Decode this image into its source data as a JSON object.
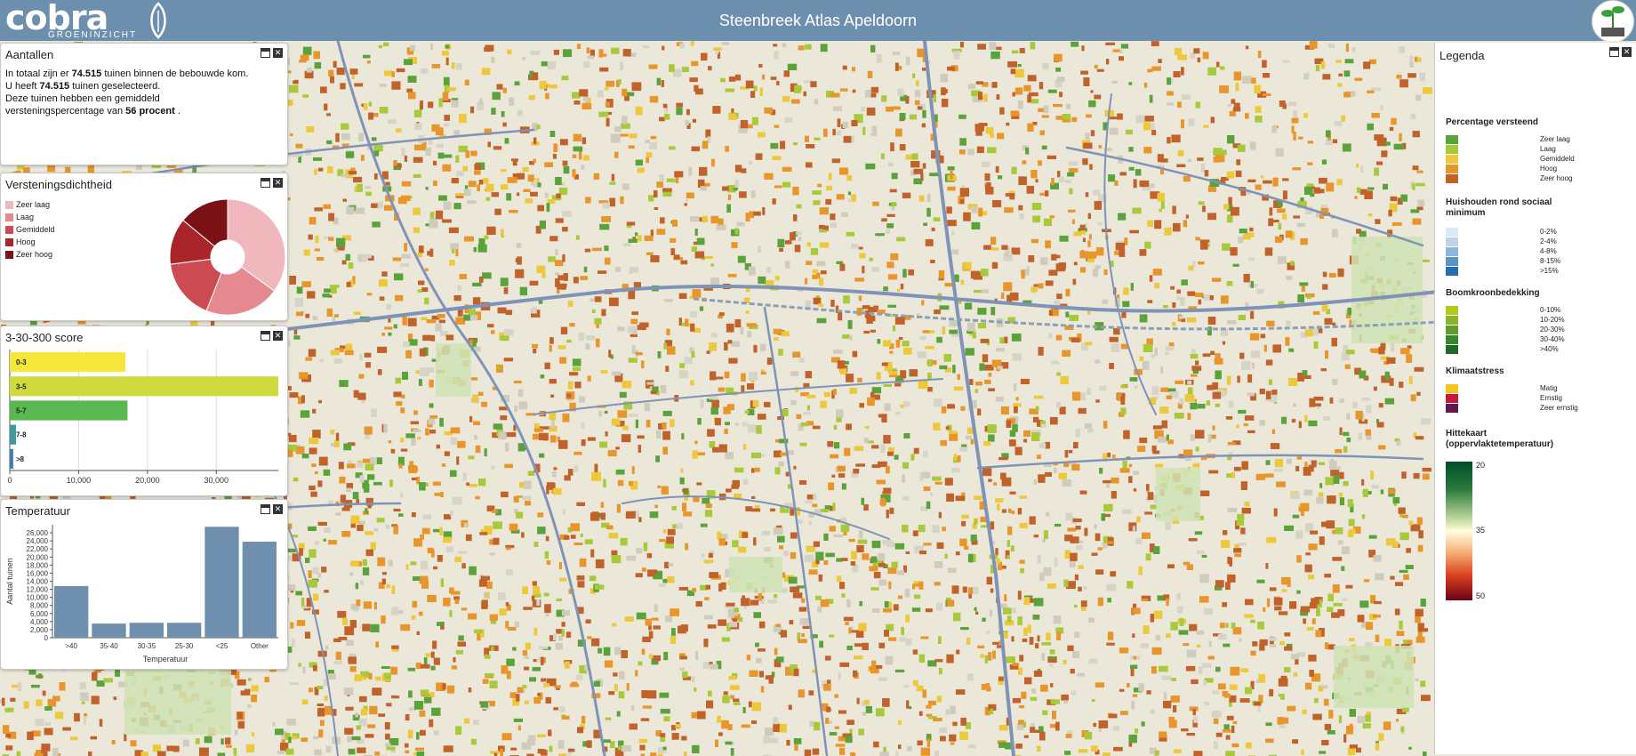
{
  "header": {
    "logo_text": "cobra",
    "logo_subtext": "GROENINZICHT",
    "title": "Steenbreek Atlas Apeldoorn"
  },
  "aantallen": {
    "title": "Aantallen",
    "line1_prefix": "In totaal zijn er",
    "line1_value": "74.515",
    "line1_suffix": "tuinen binnen de bebouwde kom.",
    "line2_prefix": "U heeft",
    "line2_value": "74.515",
    "line2_suffix": "tuinen geselecteerd.",
    "line3": "Deze tuinen hebben een gemiddeld",
    "line4_prefix": "versteningspercentage van",
    "line4_value": "56 procent",
    "line4_suffix": "."
  },
  "versteningsdichtheid": {
    "title": "Versteningsdichtheid",
    "legend": [
      {
        "label": "Zeer laag",
        "color": "#f0b8bd"
      },
      {
        "label": "Laag",
        "color": "#e58890"
      },
      {
        "label": "Gemiddeld",
        "color": "#cc4a52"
      },
      {
        "label": "Hoog",
        "color": "#a92529"
      },
      {
        "label": "Zeer hoog",
        "color": "#7a1215"
      }
    ]
  },
  "score_panel": {
    "title": "3-30-300 score"
  },
  "temperatuur_panel": {
    "title": "Temperatuur"
  },
  "chart_data": [
    {
      "type": "pie",
      "title": "Versteningsdichtheid",
      "categories": [
        "Zeer laag",
        "Laag",
        "Gemiddeld",
        "Hoog",
        "Zeer hoog"
      ],
      "values": [
        35,
        21,
        17,
        13,
        14
      ],
      "colors": [
        "#f0b8bd",
        "#e58890",
        "#cc4a52",
        "#a92529",
        "#7a1215"
      ]
    },
    {
      "type": "bar",
      "orientation": "horizontal",
      "title": "3-30-300 score",
      "categories": [
        "0-3",
        "3-5",
        "5-7",
        "7-8",
        ">8"
      ],
      "values": [
        16800,
        39000,
        17100,
        900,
        500
      ],
      "colors": [
        "#f5e83a",
        "#cfdb3c",
        "#5ab850",
        "#3d9a9e",
        "#3b7fb8"
      ],
      "xlim": [
        0,
        39000
      ],
      "xticks": [
        0,
        10000,
        20000,
        30000
      ],
      "xtick_labels": [
        "0",
        "10,000",
        "20,000",
        "30,000"
      ],
      "grid": true
    },
    {
      "type": "bar",
      "title": "Temperatuur",
      "categories": [
        ">40",
        "35-40",
        "30-35",
        "25-30",
        "<25",
        "Other"
      ],
      "values": [
        12800,
        3500,
        3700,
        3700,
        27500,
        23800
      ],
      "xlabel": "Temperatuur",
      "ylabel": "Aantal tuinen",
      "ylim": [
        0,
        28000
      ],
      "yticks": [
        0,
        2000,
        4000,
        6000,
        8000,
        10000,
        12000,
        14000,
        16000,
        18000,
        20000,
        22000,
        24000,
        26000
      ],
      "ytick_labels": [
        "0",
        "2,000",
        "4,000",
        "6,000",
        "8,000",
        "10,000",
        "12,000",
        "14,000",
        "16,000",
        "18,000",
        "20,000",
        "22,000",
        "24,000",
        "26,000"
      ],
      "color": "#6f8fae"
    }
  ],
  "legenda": {
    "title": "Legenda",
    "sections": [
      {
        "title": "Percentage versteend",
        "items": [
          {
            "label": "Zeer laag",
            "color": "#5aa33a"
          },
          {
            "label": "Laag",
            "color": "#a8c93a"
          },
          {
            "label": "Gemiddeld",
            "color": "#ecc83a"
          },
          {
            "label": "Hoog",
            "color": "#e8952b"
          },
          {
            "label": "Zeer hoog",
            "color": "#c0622a"
          }
        ]
      },
      {
        "title": "Huishouden rond sociaal minimum",
        "items": [
          {
            "label": "0-2%",
            "color": "#dde9f3"
          },
          {
            "label": "2-4%",
            "color": "#bcd3e8"
          },
          {
            "label": "4-8%",
            "color": "#8fb6da"
          },
          {
            "label": "8-15%",
            "color": "#5a93c6"
          },
          {
            "label": ">15%",
            "color": "#2a6aae"
          }
        ]
      },
      {
        "title": "Boomkroonbedekking",
        "items": [
          {
            "label": "0-10%",
            "color": "#b4c81e"
          },
          {
            "label": "10-20%",
            "color": "#8ab42a"
          },
          {
            "label": "20-30%",
            "color": "#5e9e2c"
          },
          {
            "label": "30-40%",
            "color": "#3a872a"
          },
          {
            "label": ">40%",
            "color": "#1e6a26"
          }
        ]
      },
      {
        "title": "Klimaatstress",
        "items": [
          {
            "label": "Matig",
            "color": "#f5c51e"
          },
          {
            "label": "Ernstig",
            "color": "#c8173e"
          },
          {
            "label": "Zeer ernstig",
            "color": "#5e1a4a"
          }
        ]
      }
    ],
    "heat_title": "Hittekaart (oppervlaktetemperatuur)",
    "heat_labels": {
      "top": "20",
      "mid": "35",
      "bottom": "50"
    }
  }
}
